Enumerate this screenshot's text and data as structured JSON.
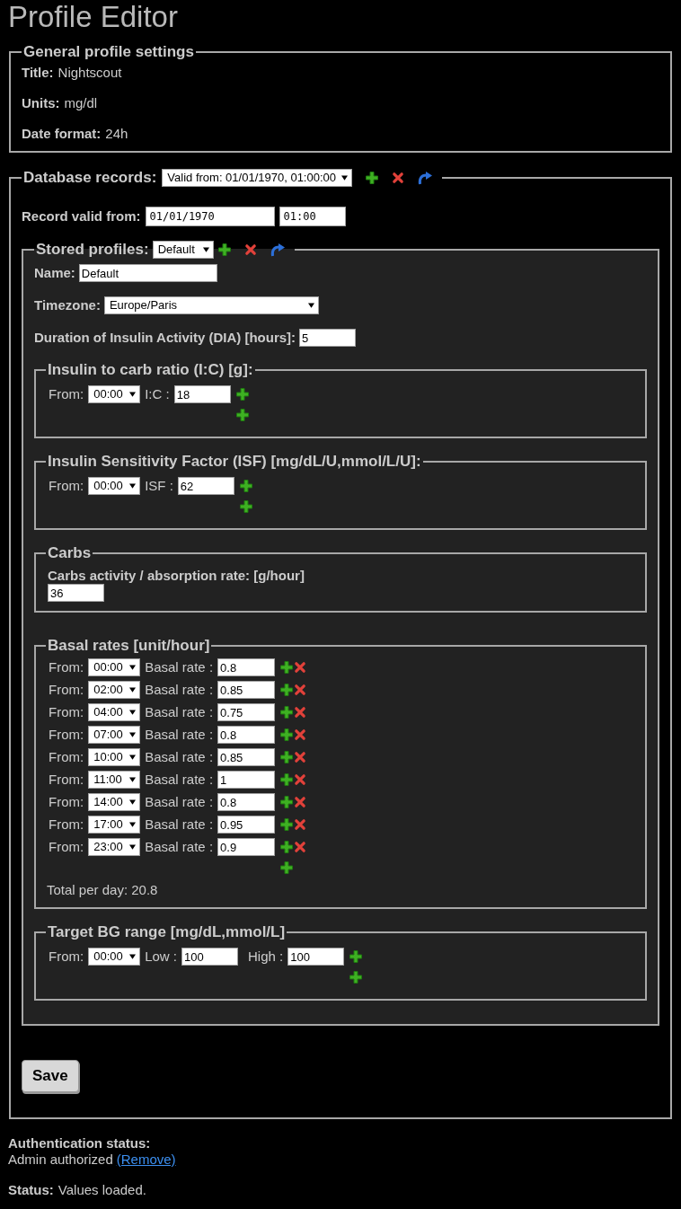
{
  "title": "Profile Editor",
  "general": {
    "legend": "General profile settings",
    "fields": [
      {
        "label": "Title:",
        "value": "Nightscout"
      },
      {
        "label": "Units:",
        "value": "mg/dl"
      },
      {
        "label": "Date format:",
        "value": "24h"
      }
    ]
  },
  "database": {
    "legend": "Database records:",
    "record": "Valid from: 01/01/1970, 01:00:00",
    "valid_from": {
      "label": "Record valid from:",
      "date": "01/01/1970",
      "time": "01:00"
    },
    "stored_profiles": {
      "legend": "Stored profiles:",
      "profile": "Default",
      "name": {
        "label": "Name:",
        "value": "Default"
      },
      "timezone": {
        "label": "Timezone:",
        "value": "Europe/Paris"
      },
      "dia": {
        "label": "Duration of Insulin Activity (DIA) [hours]:",
        "value": "5"
      },
      "ic": {
        "legend": "Insulin to carb ratio (I:C) [g]:",
        "rows": [
          {
            "from_label": "From:",
            "from": "00:00",
            "value_label": "I:C :",
            "value": "18"
          }
        ]
      },
      "isf": {
        "legend": "Insulin Sensitivity Factor (ISF) [mg/dL/U,mmol/L/U]:",
        "rows": [
          {
            "from_label": "From:",
            "from": "00:00",
            "value_label": "ISF :",
            "value": "62"
          }
        ]
      },
      "carbs": {
        "legend": "Carbs",
        "label": "Carbs activity / absorption rate: [g/hour]",
        "value": "36"
      },
      "basal": {
        "legend": "Basal rates [unit/hour]",
        "rows": [
          {
            "from_label": "From:",
            "from": "00:00",
            "value_label": "Basal rate :",
            "value": "0.8",
            "removable": true
          },
          {
            "from_label": "From:",
            "from": "02:00",
            "value_label": "Basal rate :",
            "value": "0.85",
            "removable": true
          },
          {
            "from_label": "From:",
            "from": "04:00",
            "value_label": "Basal rate :",
            "value": "0.75",
            "removable": true
          },
          {
            "from_label": "From:",
            "from": "07:00",
            "value_label": "Basal rate :",
            "value": "0.8",
            "removable": true
          },
          {
            "from_label": "From:",
            "from": "10:00",
            "value_label": "Basal rate :",
            "value": "0.85",
            "removable": true
          },
          {
            "from_label": "From:",
            "from": "11:00",
            "value_label": "Basal rate :",
            "value": "1",
            "removable": true
          },
          {
            "from_label": "From:",
            "from": "14:00",
            "value_label": "Basal rate :",
            "value": "0.8",
            "removable": true
          },
          {
            "from_label": "From:",
            "from": "17:00",
            "value_label": "Basal rate :",
            "value": "0.95",
            "removable": true
          },
          {
            "from_label": "From:",
            "from": "23:00",
            "value_label": "Basal rate :",
            "value": "0.9",
            "removable": true
          }
        ],
        "total": "Total per day: 20.8"
      },
      "target": {
        "legend": "Target BG range [mg/dL,mmol/L]",
        "rows": [
          {
            "from_label": "From:",
            "from": "00:00",
            "low_label": "Low :",
            "low": "100",
            "high_label": "High :",
            "high": "100"
          }
        ]
      }
    },
    "save": "Save"
  },
  "auth": {
    "label": "Authentication status:",
    "text": "Admin authorized",
    "link": "(Remove)"
  },
  "status": {
    "label": "Status:",
    "text": "Values loaded."
  }
}
